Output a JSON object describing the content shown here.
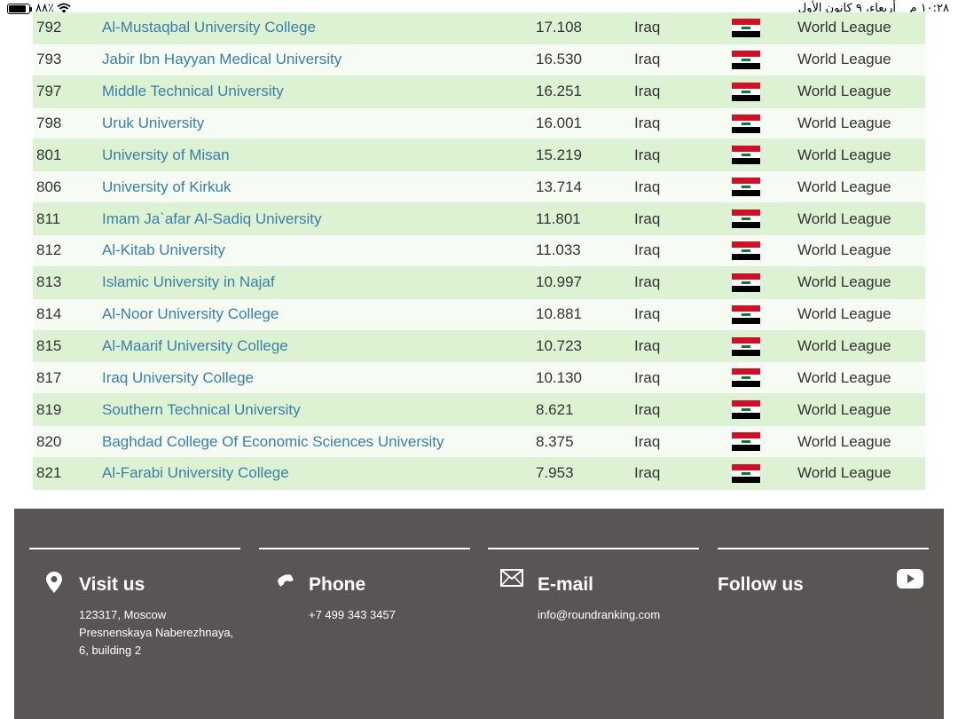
{
  "status_bar": {
    "battery_percent": "٨٨٪",
    "time": "١٠:٢٨ م",
    "date": "أربعاء، ٩ كانون الأول"
  },
  "rankings": [
    {
      "rank": "792",
      "name": "Al-Mustaqbal University College",
      "score": "17.108",
      "country": "Iraq",
      "league": "World League"
    },
    {
      "rank": "793",
      "name": "Jabir Ibn Hayyan Medical University",
      "score": "16.530",
      "country": "Iraq",
      "league": "World League"
    },
    {
      "rank": "797",
      "name": "Middle Technical University",
      "score": "16.251",
      "country": "Iraq",
      "league": "World League"
    },
    {
      "rank": "798",
      "name": "Uruk University",
      "score": "16.001",
      "country": "Iraq",
      "league": "World League"
    },
    {
      "rank": "801",
      "name": "University of Misan",
      "score": "15.219",
      "country": "Iraq",
      "league": "World League"
    },
    {
      "rank": "806",
      "name": "University of Kirkuk",
      "score": "13.714",
      "country": "Iraq",
      "league": "World League"
    },
    {
      "rank": "811",
      "name": "Imam Ja`afar Al-Sadiq University",
      "score": "11.801",
      "country": "Iraq",
      "league": "World League"
    },
    {
      "rank": "812",
      "name": "Al-Kitab University",
      "score": "11.033",
      "country": "Iraq",
      "league": "World League"
    },
    {
      "rank": "813",
      "name": "Islamic University in Najaf",
      "score": "10.997",
      "country": "Iraq",
      "league": "World League"
    },
    {
      "rank": "814",
      "name": "Al-Noor University College",
      "score": "10.881",
      "country": "Iraq",
      "league": "World League"
    },
    {
      "rank": "815",
      "name": "Al-Maarif University College",
      "score": "10.723",
      "country": "Iraq",
      "league": "World League"
    },
    {
      "rank": "817",
      "name": "Iraq University College",
      "score": "10.130",
      "country": "Iraq",
      "league": "World League"
    },
    {
      "rank": "819",
      "name": "Southern Technical University",
      "score": "8.621",
      "country": "Iraq",
      "league": "World League"
    },
    {
      "rank": "820",
      "name": "Baghdad College Of Economic Sciences University",
      "score": "8.375",
      "country": "Iraq",
      "league": "World League"
    },
    {
      "rank": "821",
      "name": "Al-Farabi University College",
      "score": "7.953",
      "country": "Iraq",
      "league": "World League"
    }
  ],
  "footer": {
    "visit": {
      "title": "Visit us",
      "address_lines": [
        "123317, Moscow",
        "Presnenskaya Naberezhnaya,",
        "6, building 2"
      ],
      "icon": "location-pin-icon"
    },
    "phone": {
      "title": "Phone",
      "number": "+7 499 343 3457",
      "icon": "phone-icon"
    },
    "email": {
      "title": "E-mail",
      "address": "info@roundranking.com",
      "icon": "envelope-icon"
    },
    "follow": {
      "title": "Follow us",
      "icon": "youtube-icon"
    }
  },
  "colors": {
    "row_odd": "#dcf2d3",
    "row_even": "#f6fbf4",
    "link": "#3a7fa8",
    "footer_bg": "#5a5555"
  }
}
